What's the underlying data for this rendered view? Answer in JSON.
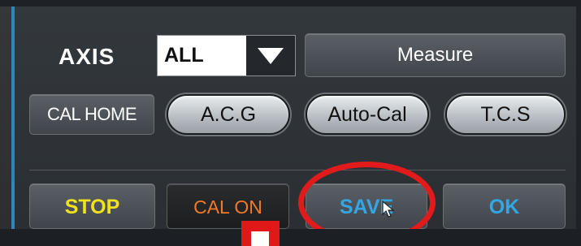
{
  "axis": {
    "label": "AXIS",
    "selected": "ALL"
  },
  "buttons": {
    "measure": "Measure",
    "cal_home": "CAL HOME",
    "acg": "A.C.G",
    "auto_cal": "Auto-Cal",
    "tcs": "T.C.S",
    "stop": "STOP",
    "cal_on": "CAL ON",
    "save": "SAVE",
    "ok": "OK"
  },
  "colors": {
    "stop_text": "#f2e21c",
    "cal_on_text": "#f07a2c",
    "save_ok_text": "#33a7e6",
    "annotation": "#e11b1b",
    "accent": "#2f86b8"
  },
  "icons": {
    "dropdown": "triangle-down-icon",
    "cursor": "mouse-pointer-icon"
  }
}
